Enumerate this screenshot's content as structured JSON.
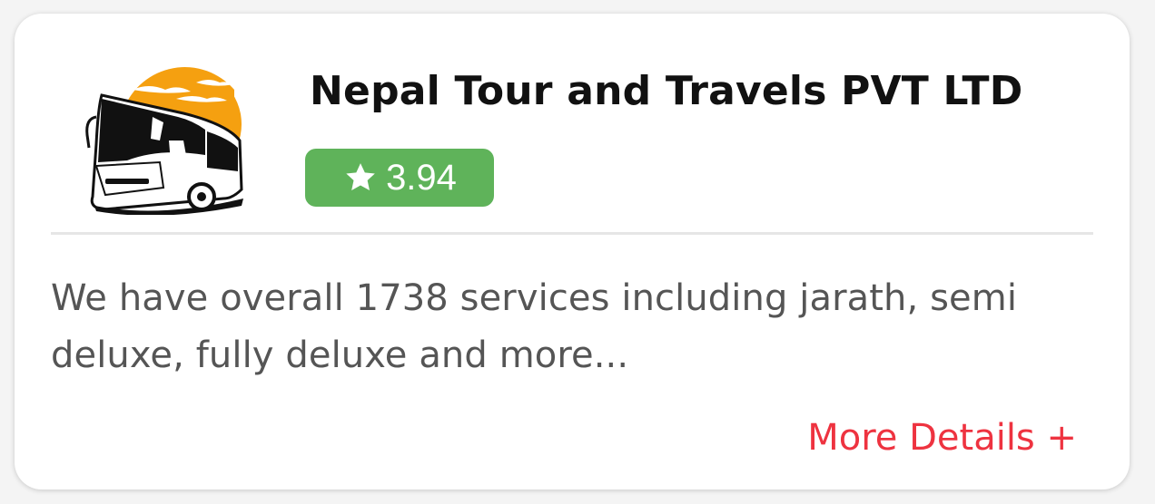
{
  "card": {
    "company_name": "Nepal Tour and Travels PVT LTD",
    "rating": "3.94",
    "description": "We have overall 1738 services including jarath, semi deluxe, fully deluxe and more...",
    "more_details_label": "More Details +"
  },
  "icons": {
    "logo": "bus-sunset-logo-icon",
    "rating": "star-icon"
  },
  "colors": {
    "rating_badge": "#5fb35a",
    "more_details": "#ee3340",
    "sun": "#f5a010"
  }
}
